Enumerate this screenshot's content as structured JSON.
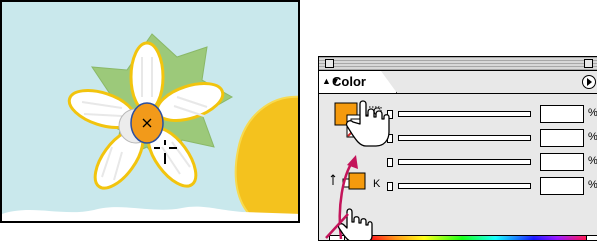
{
  "panel": {
    "tab_label": "Color",
    "tab_arrows": "▲▼",
    "rows": [
      {
        "letter": "C",
        "unit": "%",
        "value": ""
      },
      {
        "letter": "M",
        "unit": "%",
        "value": ""
      },
      {
        "letter": "Y",
        "unit": "%",
        "value": ""
      },
      {
        "letter": "K",
        "unit": "%",
        "value": ""
      }
    ]
  },
  "colors": {
    "sky": "#c6e6ea",
    "leaf": "#9cc97a",
    "flower_center": "#f29a1a",
    "petal_outline": "#f2c40e",
    "lemon": "#f2c01e",
    "fill_swatch": "#f59a0d",
    "arrow": "#c4145a"
  },
  "icons": {
    "pointer": "hand-pointer-icon",
    "swap": "swap-arrow-icon",
    "cursor": "crosshair-cursor-icon"
  }
}
